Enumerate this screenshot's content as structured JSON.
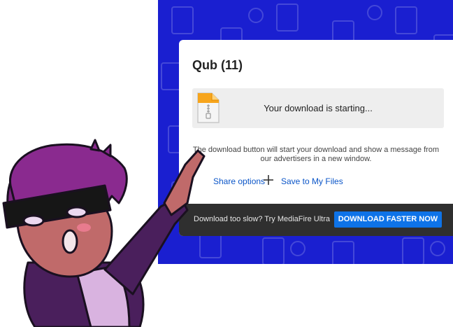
{
  "file": {
    "title": "Qub (11)",
    "icon": "zip-file-icon"
  },
  "download": {
    "status": "Your download is starting...",
    "notice_line1": "The download button will start your download and show a message from",
    "notice_line2": "our advertisers in a new window."
  },
  "actions": {
    "share_label": "Share options",
    "save_label": "Save to My Files"
  },
  "promo": {
    "text": "Download too slow? Try MediaFire Ultra",
    "button_label": "DOWNLOAD FASTER NOW"
  },
  "colors": {
    "background_blue": "#1a1fd0",
    "link_blue": "#0a55c8",
    "button_blue": "#0e73e8",
    "promo_bar": "#2f2f2f",
    "mascot_hair": "#8a2a8f",
    "mascot_skin": "#c06a6a"
  }
}
